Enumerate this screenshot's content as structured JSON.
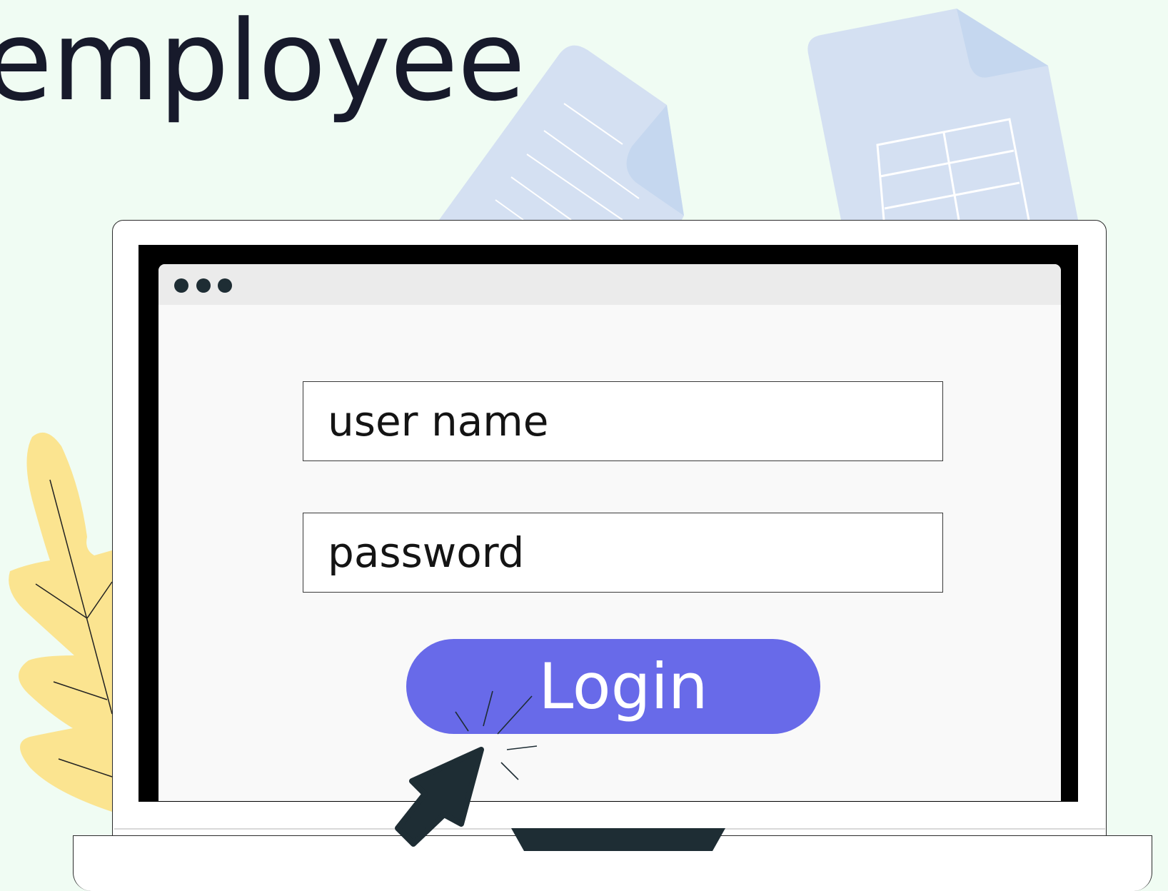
{
  "headline": "employee",
  "login_form": {
    "username_placeholder": "user name",
    "password_placeholder": "password",
    "login_label": "Login"
  },
  "colors": {
    "background": "#f0fcf3",
    "accent": "#686ae9",
    "leaf": "#fbe490",
    "document": "#d4e0f2",
    "text": "#171a2b",
    "dark": "#1e2d34"
  },
  "icons": [
    "document-icon",
    "spreadsheet-icon",
    "leaf-icon",
    "window-dots-icon",
    "cursor-arrow-icon",
    "click-burst-icon"
  ]
}
